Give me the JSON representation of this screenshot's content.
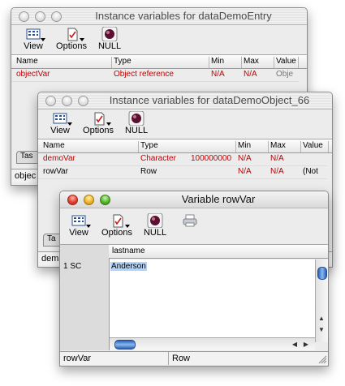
{
  "window1": {
    "title": "Instance variables for dataDemoEntry",
    "toolbar": {
      "view": "View",
      "options": "Options",
      "null": "NULL"
    },
    "columns": [
      "Name",
      "Type",
      "Min",
      "Max",
      "Value"
    ],
    "rows": [
      {
        "name": "objectVar",
        "type": "Object reference",
        "min": "N/A",
        "max": "N/A",
        "value": "Obje"
      }
    ],
    "tab_label": "Tas",
    "status_left": "objec"
  },
  "window2": {
    "title": "Instance variables for dataDemoObject_66",
    "toolbar": {
      "view": "View",
      "options": "Options",
      "null": "NULL"
    },
    "columns": [
      "Name",
      "Type",
      "Min",
      "Max",
      "Value"
    ],
    "rows": [
      {
        "name": "demoVar",
        "type": "Character",
        "size": "100000000",
        "min": "N/A",
        "max": "N/A",
        "value": ""
      },
      {
        "name": "rowVar",
        "type": "Row",
        "min": "N/A",
        "max": "N/A",
        "value": "(Not"
      }
    ],
    "tab_label": "Ta",
    "status_left": "dem"
  },
  "window3": {
    "title": "Variable rowVar",
    "toolbar": {
      "view": "View",
      "options": "Options",
      "null": "NULL"
    },
    "column_header": "lastname",
    "row_label": "1 SC",
    "cell_value": "Anderson",
    "status_left": "rowVar",
    "status_right": "Row"
  },
  "colors": {
    "accent_red": "#c00000",
    "selection": "#b5d3f7",
    "scroll_thumb": "#3a74c8"
  }
}
